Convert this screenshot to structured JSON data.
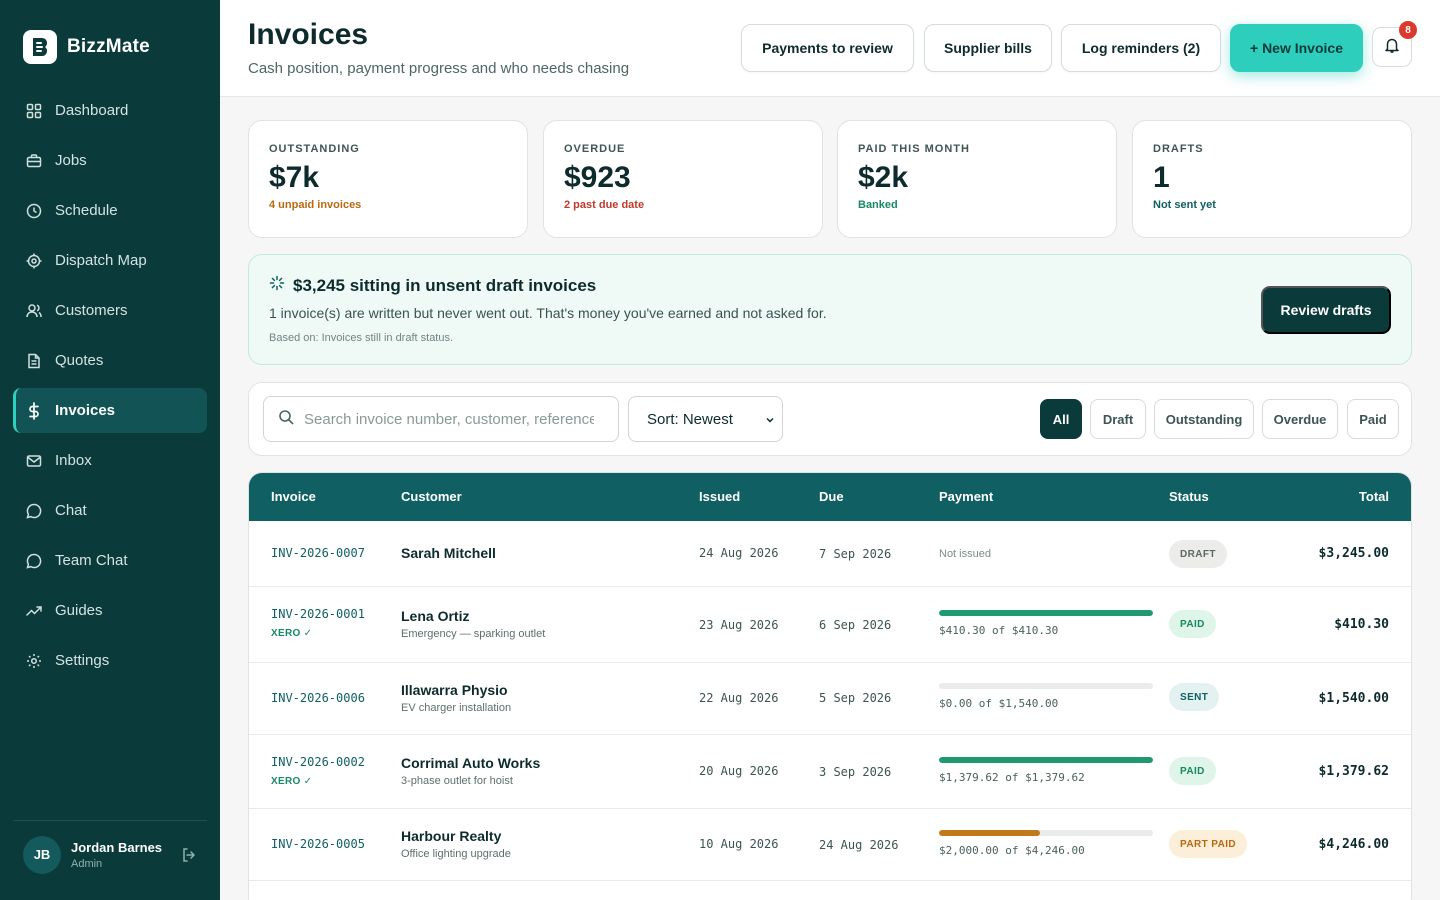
{
  "brand": {
    "name": "BizzMate"
  },
  "nav": {
    "items": [
      {
        "label": "Dashboard",
        "icon": "grid-icon"
      },
      {
        "label": "Jobs",
        "icon": "briefcase-icon"
      },
      {
        "label": "Schedule",
        "icon": "clock-icon"
      },
      {
        "label": "Dispatch Map",
        "icon": "target-icon"
      },
      {
        "label": "Customers",
        "icon": "users-icon"
      },
      {
        "label": "Quotes",
        "icon": "document-icon"
      },
      {
        "label": "Invoices",
        "icon": "dollar-icon",
        "active": true
      },
      {
        "label": "Inbox",
        "icon": "mail-icon"
      },
      {
        "label": "Chat",
        "icon": "chat-icon"
      },
      {
        "label": "Team Chat",
        "icon": "chat-icon"
      },
      {
        "label": "Guides",
        "icon": "trend-icon"
      },
      {
        "label": "Settings",
        "icon": "gear-icon"
      }
    ]
  },
  "user": {
    "initials": "JB",
    "name": "Jordan Barnes",
    "role": "Admin"
  },
  "header": {
    "title": "Invoices",
    "subtitle": "Cash position, payment progress and who needs chasing",
    "payments_to_review": "Payments to review",
    "supplier_bills": "Supplier bills",
    "log_reminders": "Log reminders (2)",
    "new_invoice": "+ New Invoice",
    "notification_count": "8"
  },
  "stats": [
    {
      "label": "OUTSTANDING",
      "value": "$7k",
      "note": "4 unpaid invoices",
      "note_color": "#b86a12"
    },
    {
      "label": "OVERDUE",
      "value": "$923",
      "note": "2 past due date",
      "note_color": "#c0392b"
    },
    {
      "label": "PAID THIS MONTH",
      "value": "$2k",
      "note": "Banked",
      "note_color": "#178a60"
    },
    {
      "label": "DRAFTS",
      "value": "1",
      "note": "Not sent yet",
      "note_color": "#0f5f63"
    }
  ],
  "insight": {
    "title": "$3,245 sitting in unsent draft invoices",
    "text": "1 invoice(s) are written but never went out. That's money you've earned and not asked for.",
    "basis": "Based on: Invoices still in draft status.",
    "action": "Review drafts"
  },
  "filters": {
    "search_placeholder": "Search invoice number, customer, reference…",
    "sort_label": "Sort: Newest",
    "chips": [
      "All",
      "Draft",
      "Outstanding",
      "Overdue",
      "Paid"
    ],
    "active_chip": "All"
  },
  "table": {
    "columns": [
      "Invoice",
      "Customer",
      "Issued",
      "Due",
      "Payment",
      "Status",
      "Total"
    ],
    "rows": [
      {
        "invoice": "INV-2026-0007",
        "xero": "",
        "customer": "Sarah Mitchell",
        "job": "",
        "issued": "24 Aug 2026",
        "due": "7 Sep 2026",
        "payment_text": "Not issued",
        "paid_fraction": null,
        "bar_color": "",
        "status": "DRAFT",
        "status_bg": "#ececea",
        "status_fg": "#5b6866",
        "total": "$3,245.00"
      },
      {
        "invoice": "INV-2026-0001",
        "xero": "XERO ✓",
        "customer": "Lena Ortiz",
        "job": "Emergency — sparking outlet",
        "issued": "23 Aug 2026",
        "due": "6 Sep 2026",
        "payment_text": "$410.30 of $410.30",
        "paid_fraction": 1.0,
        "bar_color": "#1f9a6e",
        "status": "PAID",
        "status_bg": "#dff5ea",
        "status_fg": "#178a60",
        "total": "$410.30"
      },
      {
        "invoice": "INV-2026-0006",
        "xero": "",
        "customer": "Illawarra Physio",
        "job": "EV charger installation",
        "issued": "22 Aug 2026",
        "due": "5 Sep 2026",
        "payment_text": "$0.00 of $1,540.00",
        "paid_fraction": 0.0,
        "bar_color": "#1f9a6e",
        "status": "SENT",
        "status_bg": "#e4f1f1",
        "status_fg": "#0f5f63",
        "total": "$1,540.00"
      },
      {
        "invoice": "INV-2026-0002",
        "xero": "XERO ✓",
        "customer": "Corrimal Auto Works",
        "job": "3-phase outlet for hoist",
        "issued": "20 Aug 2026",
        "due": "3 Sep 2026",
        "payment_text": "$1,379.62 of $1,379.62",
        "paid_fraction": 1.0,
        "bar_color": "#1f9a6e",
        "status": "PAID",
        "status_bg": "#dff5ea",
        "status_fg": "#178a60",
        "total": "$1,379.62"
      },
      {
        "invoice": "INV-2026-0005",
        "xero": "",
        "customer": "Harbour Realty",
        "job": "Office lighting upgrade",
        "issued": "10 Aug 2026",
        "due": "24 Aug 2026",
        "payment_text": "$2,000.00 of $4,246.00",
        "paid_fraction": 0.471,
        "bar_color": "#c07a1c",
        "status": "PART PAID",
        "status_bg": "#fbefd9",
        "status_fg": "#b86a12",
        "total": "$4,246.00"
      }
    ]
  },
  "colors": {
    "sidebar": "#0b3a3b",
    "accent": "#2dcfbc",
    "table_header": "#0f5f63"
  }
}
